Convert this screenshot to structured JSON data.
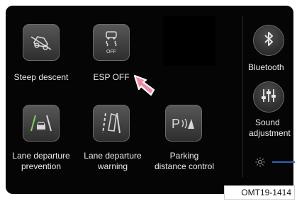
{
  "tiles": [
    {
      "label": "Steep descent",
      "icon": "steep-descent-icon"
    },
    {
      "label": "ESP OFF",
      "icon": "esp-off-icon",
      "icon_text": "OFF"
    },
    {
      "label_line1": "Lane departure",
      "label_line2": "prevention",
      "icon": "lane-departure-prevention-icon"
    },
    {
      "label_line1": "Lane departure",
      "label_line2": "warning",
      "icon": "lane-departure-warning-icon"
    },
    {
      "label_line1": "Parking",
      "label_line2": "distance control",
      "icon": "parking-distance-control-icon",
      "icon_text": "P"
    }
  ],
  "side": {
    "bluetooth_label": "Bluetooth",
    "sound_line1": "Sound",
    "sound_line2": "adjustment",
    "brightness_icon": "sun-icon"
  },
  "colors": {
    "screen": "#050505",
    "tile_border": "#6b6b6b",
    "label": "#ececec",
    "pointer": "#f28aa6",
    "slider": "#2e63c0"
  },
  "figure_code": "OMT19-1414"
}
